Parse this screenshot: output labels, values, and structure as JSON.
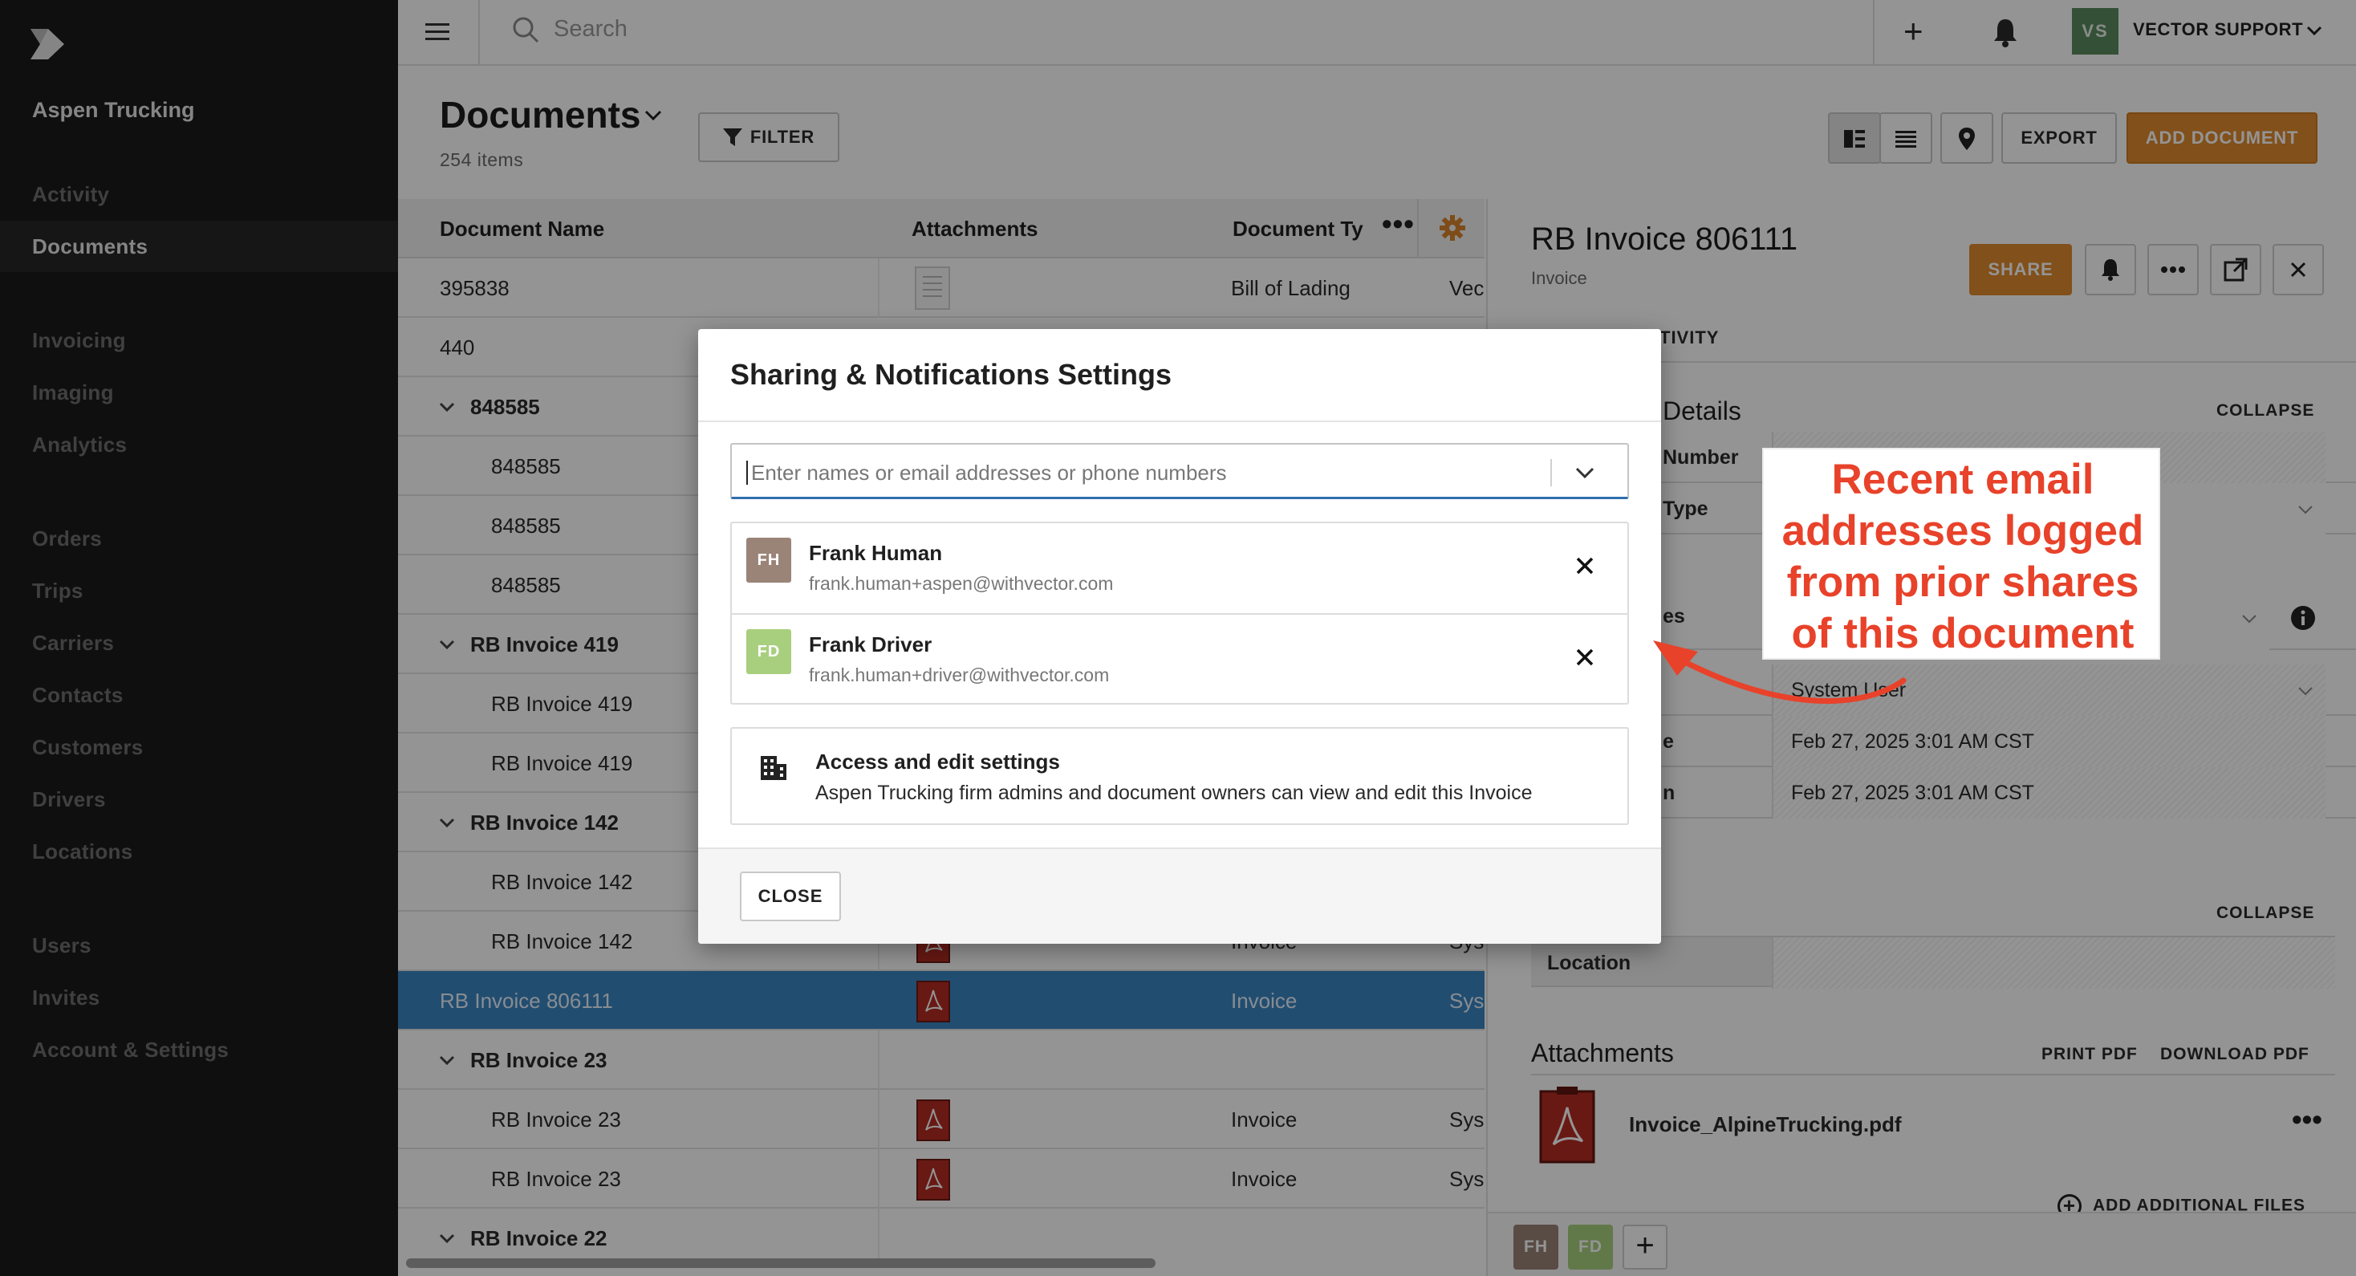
{
  "app": {
    "company": "Aspen Trucking"
  },
  "sidebar": {
    "items": [
      {
        "label": "Activity"
      },
      {
        "label": "Documents"
      },
      {
        "label": "Invoicing"
      },
      {
        "label": "Imaging"
      },
      {
        "label": "Analytics"
      },
      {
        "label": "Orders"
      },
      {
        "label": "Trips"
      },
      {
        "label": "Carriers"
      },
      {
        "label": "Contacts"
      },
      {
        "label": "Customers"
      },
      {
        "label": "Drivers"
      },
      {
        "label": "Locations"
      },
      {
        "label": "Users"
      },
      {
        "label": "Invites"
      },
      {
        "label": "Account & Settings"
      }
    ],
    "active_item": "Documents"
  },
  "topbar": {
    "search_placeholder": "Search",
    "user_initials": "VS",
    "user_name": "VECTOR SUPPORT"
  },
  "documents": {
    "title": "Documents",
    "count": "254 items",
    "filter_label": "FILTER",
    "export_label": "EXPORT",
    "add_label": "ADD DOCUMENT"
  },
  "table": {
    "columns": [
      "Document Name",
      "Attachments",
      "Document Ty"
    ],
    "more": "•••",
    "rows": [
      {
        "name": "395838",
        "type": "Bill of Lading",
        "extra": "Vec"
      },
      {
        "name": "440",
        "type": "",
        "extra": ""
      },
      {
        "name": "848585",
        "type": "",
        "extra": ""
      },
      {
        "name": "848585",
        "type": "",
        "extra": ""
      },
      {
        "name": "848585",
        "type": "",
        "extra": ""
      },
      {
        "name": "848585",
        "type": "",
        "extra": ""
      },
      {
        "name": "RB Invoice 419",
        "type": "",
        "extra": ""
      },
      {
        "name": "RB Invoice 419",
        "type": "",
        "extra": ""
      },
      {
        "name": "RB Invoice 419",
        "type": "",
        "extra": ""
      },
      {
        "name": "RB Invoice 142",
        "type": "",
        "extra": ""
      },
      {
        "name": "RB Invoice 142",
        "type": "",
        "extra": ""
      },
      {
        "name": "RB Invoice 142",
        "type": "Invoice",
        "extra": "Sys"
      },
      {
        "name": "RB Invoice 806111",
        "type": "Invoice",
        "extra": "Sys"
      },
      {
        "name": "RB Invoice 23",
        "type": "",
        "extra": ""
      },
      {
        "name": "RB Invoice 23",
        "type": "Invoice",
        "extra": "Sys"
      },
      {
        "name": "RB Invoice 23",
        "type": "Invoice",
        "extra": "Sys"
      },
      {
        "name": "RB Invoice 22",
        "type": "",
        "extra": ""
      }
    ]
  },
  "detail": {
    "title": "RB Invoice 806111",
    "subtitle": "Invoice",
    "share_label": "SHARE",
    "tab_activity": "TIVITY",
    "details_section": "Details",
    "collapse": "COLLAPSE",
    "fields": [
      {
        "label": "Number",
        "value": ""
      },
      {
        "label": "Type",
        "value": ""
      },
      {
        "label": "es",
        "value": ""
      },
      {
        "label": "",
        "value": "System User"
      },
      {
        "label": "e",
        "value": "Feb 27, 2025 3:01 AM CST"
      },
      {
        "label": "n",
        "value": "Feb 27, 2025 3:01 AM CST"
      }
    ],
    "collapse2": "COLLAPSE",
    "location_label": "Location",
    "attachments_title": "Attachments",
    "print_pdf": "PRINT PDF",
    "download_pdf": "DOWNLOAD PDF",
    "file_name": "Invoice_AlpineTrucking.pdf",
    "file_more": "•••",
    "add_files": "ADD ADDITIONAL FILES",
    "followers": [
      "FH",
      "FD"
    ]
  },
  "modal": {
    "title": "Sharing & Notifications Settings",
    "input_placeholder": "Enter names or email addresses or phone numbers",
    "recipients": [
      {
        "initials": "FH",
        "name": "Frank Human",
        "email": "frank.human+aspen@withvector.com",
        "color": "#9a8478"
      },
      {
        "initials": "FD",
        "name": "Frank Driver",
        "email": "frank.human+driver@withvector.com",
        "color": "#a8cf7e"
      }
    ],
    "access_title": "Access and edit settings",
    "access_desc": "Aspen Trucking firm admins and document owners can view and edit this Invoice",
    "close_label": "CLOSE"
  },
  "annotation": {
    "lines": [
      "Recent email",
      "addresses logged",
      "from prior shares",
      "of this document"
    ],
    "color": "#e8422a"
  },
  "colors": {
    "accent": "#e08a2e",
    "selected_row": "#3a86c2",
    "sidebar_bg": "#1a1a1a"
  }
}
